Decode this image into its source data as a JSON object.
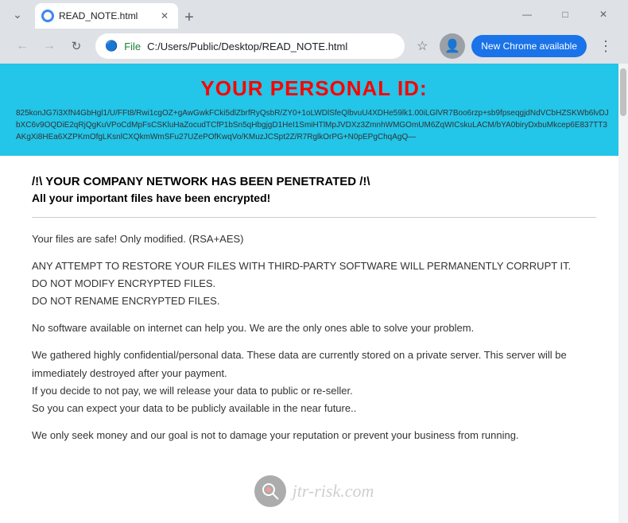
{
  "browser": {
    "tab": {
      "title": "READ_NOTE.html",
      "favicon_color": "#4285f4"
    },
    "address_bar": {
      "scheme": "File",
      "url": "C:/Users/Public/Desktop/READ_NOTE.html"
    },
    "update_button": "New Chrome available",
    "window_controls": {
      "minimize": "—",
      "maximize": "□",
      "close": "✕"
    }
  },
  "page": {
    "id_banner": {
      "title": "YOUR PERSONAL ID:",
      "code": "825konJG7i3XfN4GbHgl1/U/FFt8/Rwi1cgOZ+gAwGwkFCki5dlZbrfRyQsbR/ZY0+1oLWDlSfeQlbvuU4XDHe59lk1.00iLGlVR7Boo6rzp+sb9fpseqgjdNdVCbHZSKWb6lvDJbXC6v9OQDiE2qRjQgKuVPoCdMpFsCSKluHaZocudTCfP1bSn5qHbgjgD1HeI1SmiHTlMpJVDXz3ZmnhWMGOmUM6ZqWICskuLACM/bYA0biryDxbuMkcep6E837TT3AKgXi8HEa6XZPKmOfgLKsnlCXQkmWmSFu27UZePOfKwqVo/KMuzJCSpt2Z/R7RglkOrPG+N0pEPgChqAgQ—"
    },
    "heading": "/!\\ YOUR COMPANY NETWORK HAS BEEN PENETRATED /!\\",
    "subheading": "All your important files have been encrypted!",
    "paragraphs": [
      "Your files are safe! Only modified. (RSA+AES)",
      "ANY ATTEMPT TO RESTORE YOUR FILES WITH THIRD-PARTY SOFTWARE WILL PERMANENTLY CORRUPT IT.\nDO NOT MODIFY ENCRYPTED FILES.\nDO NOT RENAME ENCRYPTED FILES.",
      "No software available on internet can help you. We are the only ones able to solve your problem.",
      "We gathered highly confidential/personal data. These data are currently stored on a private server. This server will be immediately destroyed after your payment.\nIf you decide to not pay, we will release your data to public or re-seller.\nSo you can expect your data to be publicly available in the near future..",
      "We only seek money and our goal is not to damage your reputation or prevent your business from running."
    ]
  },
  "icons": {
    "back": "←",
    "forward": "→",
    "reload": "↻",
    "bookmark": "☆",
    "profile": "👤",
    "menu": "⋮",
    "file_icon": "📄"
  }
}
